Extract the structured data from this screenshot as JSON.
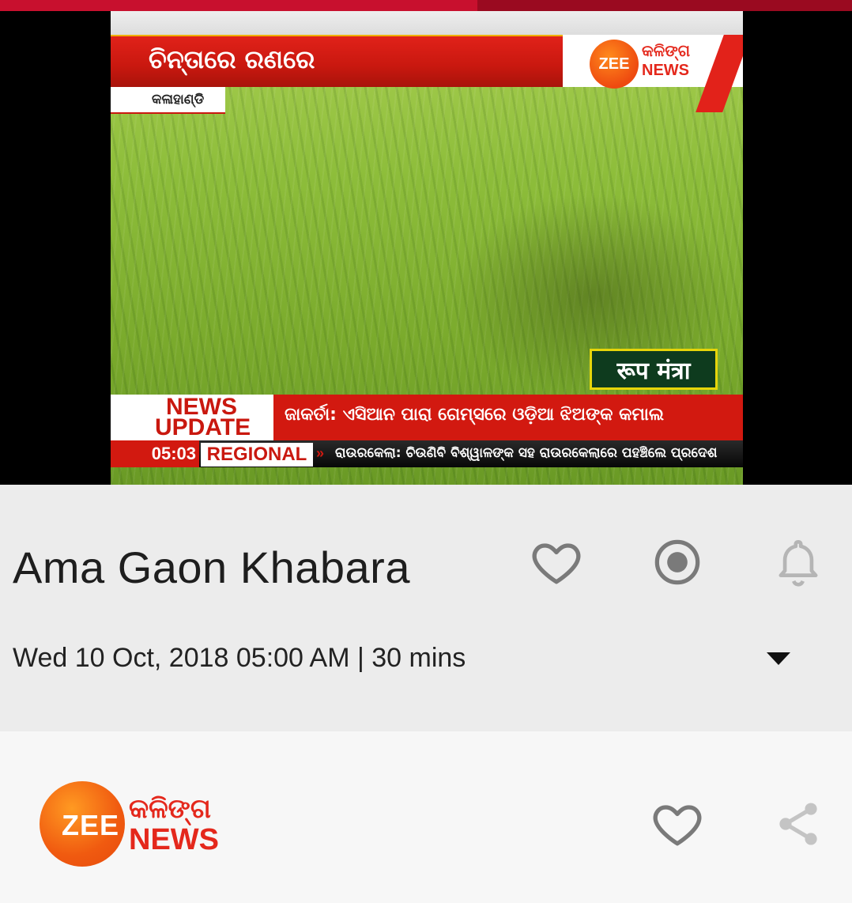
{
  "player": {
    "progress_fraction": 0.56,
    "overlay": {
      "banner_title": "ଚିନ୍ତାରେ ରଣରେ",
      "location": "କଳାହାଣ୍ଡି",
      "channel_logo": {
        "brand": "ZEE",
        "line1": "କଳିଙ୍ଗ",
        "line2": "NEWS"
      },
      "show_tag": "रूप मंत्रा",
      "news_update_line1": "NEWS",
      "news_update_line2": "UPDATE",
      "headline": "ଜାକର୍ତା: ଏସିଆନ ପାରା ଗେମ୍ସରେ ଓଡ଼ିଆ ଝିଅଙ୍କ କମାଲ",
      "ticker_time": "05:03",
      "ticker_category": "REGIONAL",
      "ticker_text": "ରାଉରକେଲା: ଚିଉଣିବି ବିଶ୍ୱାଳଙ୍କ ସହ ରାଉରକେଲାରେ ପହଞ୍ଚିଲେ ପ୍ରଦେଶ"
    }
  },
  "program": {
    "title": "Ama Gaon Khabara",
    "schedule": "Wed 10 Oct, 2018 05:00 AM | 30 mins",
    "icons": {
      "favorite": "heart-outline-icon",
      "record": "record-icon",
      "reminder": "bell-icon",
      "expand": "chevron-down-icon"
    }
  },
  "channel": {
    "logo": {
      "brand": "ZEE",
      "line1": "କଳିଙ୍ଗ",
      "line2": "NEWS"
    },
    "icons": {
      "favorite": "heart-outline-icon",
      "share": "share-icon"
    }
  },
  "colors": {
    "brand_red": "#c8102e",
    "brand_orange": "#f05a10",
    "icon_gray": "#a9a9a9",
    "icon_dark_gray": "#7a7a7a"
  }
}
